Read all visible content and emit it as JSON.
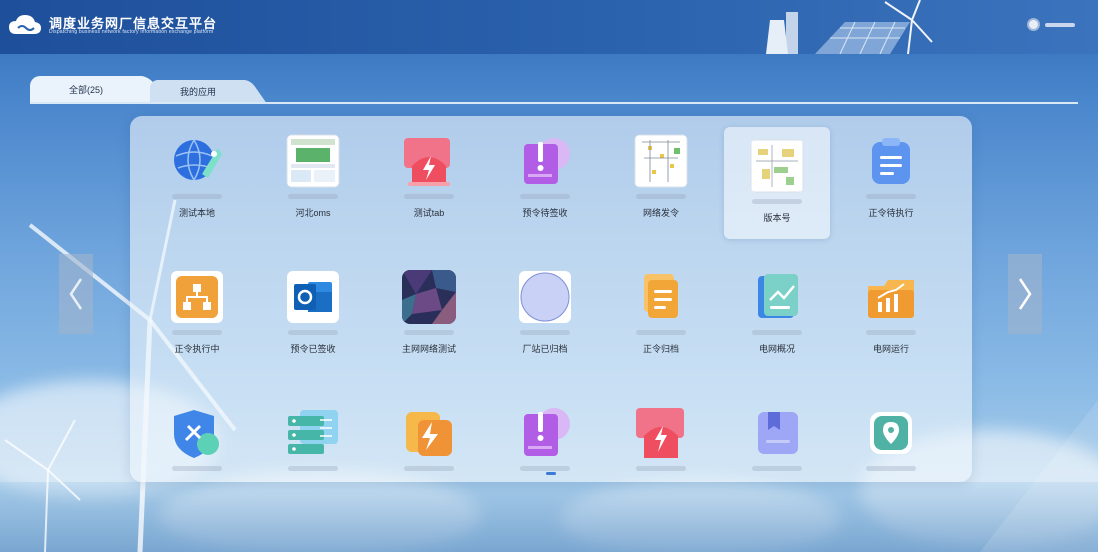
{
  "header": {
    "title": "调度业务网厂信息交互平台",
    "subtitle": "Dispatching business network factory information exchange platform"
  },
  "tabs": [
    {
      "label": "全部(25)",
      "active": true
    },
    {
      "label": "我的应用",
      "active": false
    }
  ],
  "apps": [
    {
      "label": "测试本地",
      "icon": "globe-rocket-icon"
    },
    {
      "label": "河北oms",
      "icon": "oms-screenshot-icon"
    },
    {
      "label": "测试tab",
      "icon": "red-lightning-icon"
    },
    {
      "label": "预令待签收",
      "icon": "purple-alert-icon"
    },
    {
      "label": "网络发令",
      "icon": "network-diagram-icon"
    },
    {
      "label": "版本号",
      "icon": "version-diagram-icon",
      "selected": true
    },
    {
      "label": "正令待执行",
      "icon": "blue-clipboard-icon"
    },
    {
      "label": "正令执行中",
      "icon": "orange-hierarchy-icon"
    },
    {
      "label": "预令已签收",
      "icon": "outlook-icon"
    },
    {
      "label": "主网网络测试",
      "icon": "dark-polygon-icon"
    },
    {
      "label": "厂站已归档",
      "icon": "lavender-circle-icon"
    },
    {
      "label": "正令归档",
      "icon": "orange-document-icon"
    },
    {
      "label": "电网概况",
      "icon": "blue-chart-doc-icon"
    },
    {
      "label": "电网运行",
      "icon": "orange-folder-chart-icon"
    },
    {
      "label": "",
      "icon": "blue-shield-tools-icon"
    },
    {
      "label": "",
      "icon": "server-settings-icon"
    },
    {
      "label": "",
      "icon": "orange-lightning-icon"
    },
    {
      "label": "",
      "icon": "purple-alert-icon"
    },
    {
      "label": "",
      "icon": "red-lightning-icon"
    },
    {
      "label": "",
      "icon": "bookmark-book-icon"
    },
    {
      "label": "",
      "icon": "map-pin-icon"
    }
  ],
  "colors": {
    "accent": "#3a7bd5",
    "header": "#2b62ad"
  }
}
